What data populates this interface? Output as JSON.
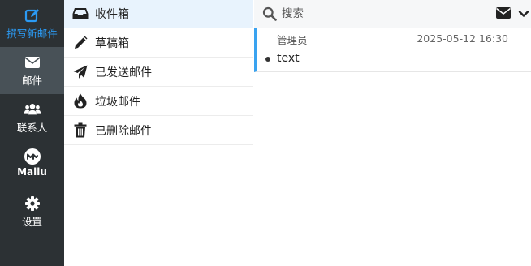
{
  "rail": {
    "compose_label": "撰写新邮件",
    "mail_label": "邮件",
    "contacts_label": "联系人",
    "mailu_label": "Mailu",
    "settings_label": "设置",
    "active_color": "#2b9af3",
    "bg_color": "#2c3134",
    "active_bg_color": "#485157"
  },
  "folders": [
    {
      "label": "收件箱",
      "icon": "inbox-icon",
      "active": true
    },
    {
      "label": "草稿箱",
      "icon": "pencil-icon",
      "active": false
    },
    {
      "label": "已发送邮件",
      "icon": "paper-plane-icon",
      "active": false
    },
    {
      "label": "垃圾邮件",
      "icon": "fire-icon",
      "active": false
    },
    {
      "label": "已删除邮件",
      "icon": "trash-icon",
      "active": false
    }
  ],
  "search": {
    "placeholder": "搜索",
    "value": ""
  },
  "messages": [
    {
      "sender": "管理员",
      "date": "2025-05-12 16:30",
      "subject": "text",
      "unread": true
    }
  ]
}
